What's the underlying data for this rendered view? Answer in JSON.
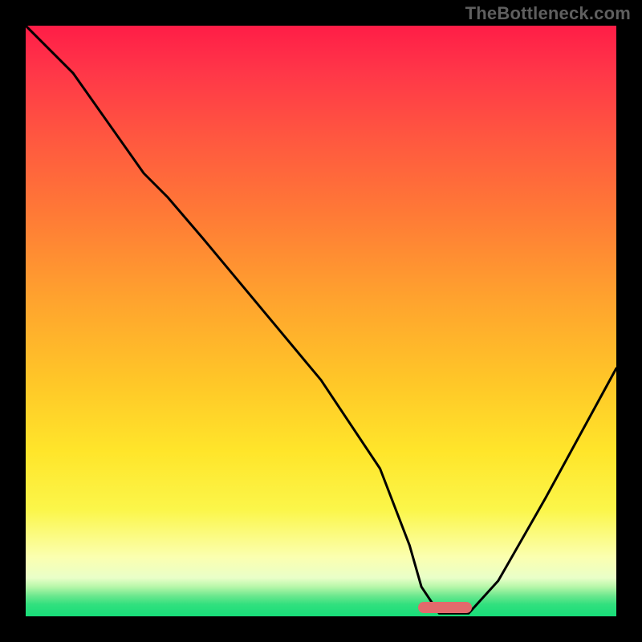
{
  "watermark": "TheBottleneck.com",
  "gradient": {
    "stops": [
      {
        "pct": 0,
        "color": "#ff1d47"
      },
      {
        "pct": 8,
        "color": "#ff3748"
      },
      {
        "pct": 20,
        "color": "#ff5a3f"
      },
      {
        "pct": 32,
        "color": "#ff7a36"
      },
      {
        "pct": 46,
        "color": "#ffa22e"
      },
      {
        "pct": 60,
        "color": "#ffc628"
      },
      {
        "pct": 72,
        "color": "#ffe52a"
      },
      {
        "pct": 82,
        "color": "#fbf64a"
      },
      {
        "pct": 90,
        "color": "#fbffb0"
      },
      {
        "pct": 93.5,
        "color": "#e9ffc8"
      },
      {
        "pct": 95,
        "color": "#b7f7a9"
      },
      {
        "pct": 96.5,
        "color": "#6de88f"
      },
      {
        "pct": 98,
        "color": "#31e07e"
      },
      {
        "pct": 100,
        "color": "#17dd79"
      }
    ]
  },
  "optimum_marker": {
    "color": "#e36a6c",
    "x_frac_left": 0.665,
    "x_frac_right": 0.755,
    "y_frac": 0.985
  },
  "chart_data": {
    "type": "line",
    "title": "",
    "xlabel": "",
    "ylabel": "",
    "xlim": [
      0,
      100
    ],
    "ylim": [
      0,
      100
    ],
    "x": [
      0,
      8,
      20,
      24,
      30,
      40,
      50,
      60,
      65,
      67,
      70,
      73,
      75,
      80,
      88,
      100
    ],
    "y": [
      100,
      92,
      75,
      71,
      64,
      52,
      40,
      25,
      12,
      5,
      0.5,
      0.5,
      0.5,
      6,
      20,
      42
    ],
    "optimum_range": {
      "x_start": 66.5,
      "x_end": 75.5,
      "y": 0.5
    },
    "note": "Values are estimated from pixels; axes unlabeled in source image."
  }
}
